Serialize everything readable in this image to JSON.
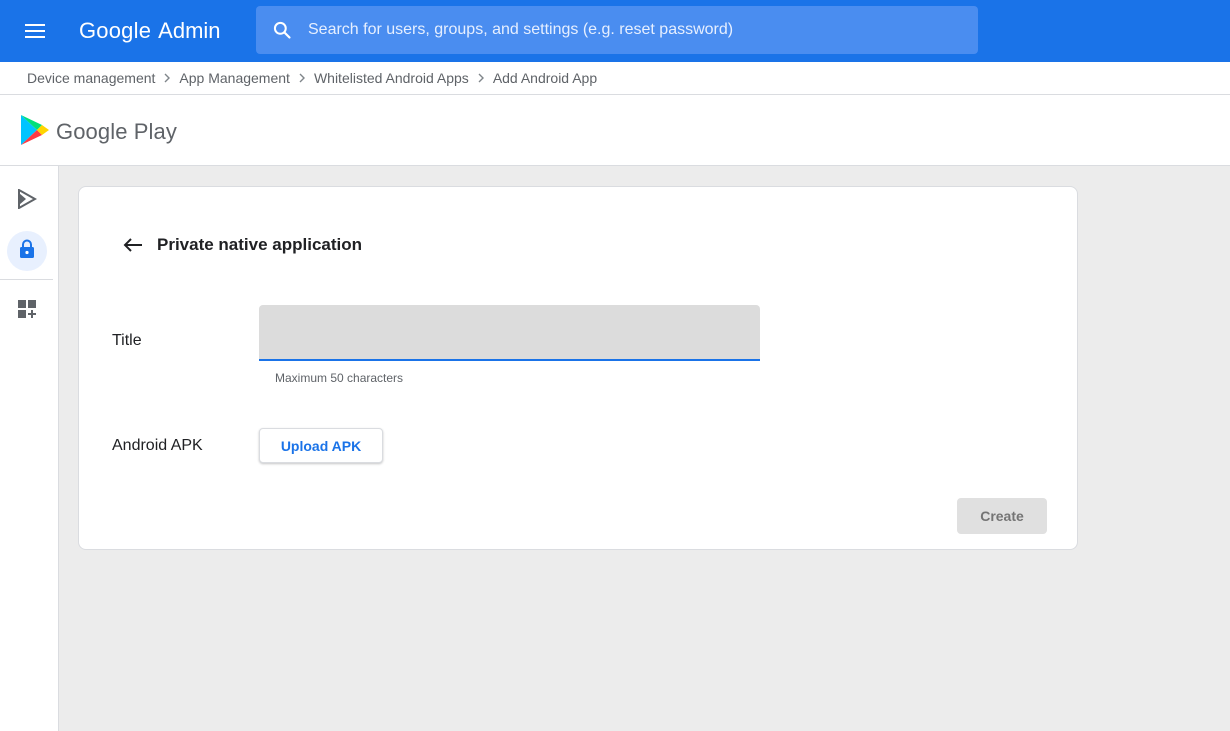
{
  "topbar": {
    "brand_google": "Google",
    "brand_product": "Admin",
    "search_placeholder": "Search for users, groups, and settings (e.g. reset password)",
    "search_value": "",
    "menu_icon": "hamburger-menu-icon",
    "search_icon": "search-icon",
    "accent_color": "#1a73e8"
  },
  "breadcrumb": {
    "items": [
      "Device management",
      "App Management",
      "Whitelisted Android Apps",
      "Add Android App"
    ],
    "separator_icon": "chevron-right-icon"
  },
  "play_header": {
    "logo_icon": "google-play-icon",
    "logo_text": "Google Play"
  },
  "rail": {
    "items": [
      {
        "icon": "play-apps-icon",
        "active": false
      },
      {
        "icon": "lock-icon",
        "active": true
      },
      {
        "icon": "add-widget-icon",
        "active": false
      }
    ]
  },
  "form": {
    "back_icon": "arrow-back-icon",
    "heading": "Private native application",
    "title_label": "Title",
    "title_value": "",
    "title_helper": "Maximum 50 characters",
    "apk_label": "Android APK",
    "upload_label": "Upload APK",
    "create_label": "Create"
  }
}
